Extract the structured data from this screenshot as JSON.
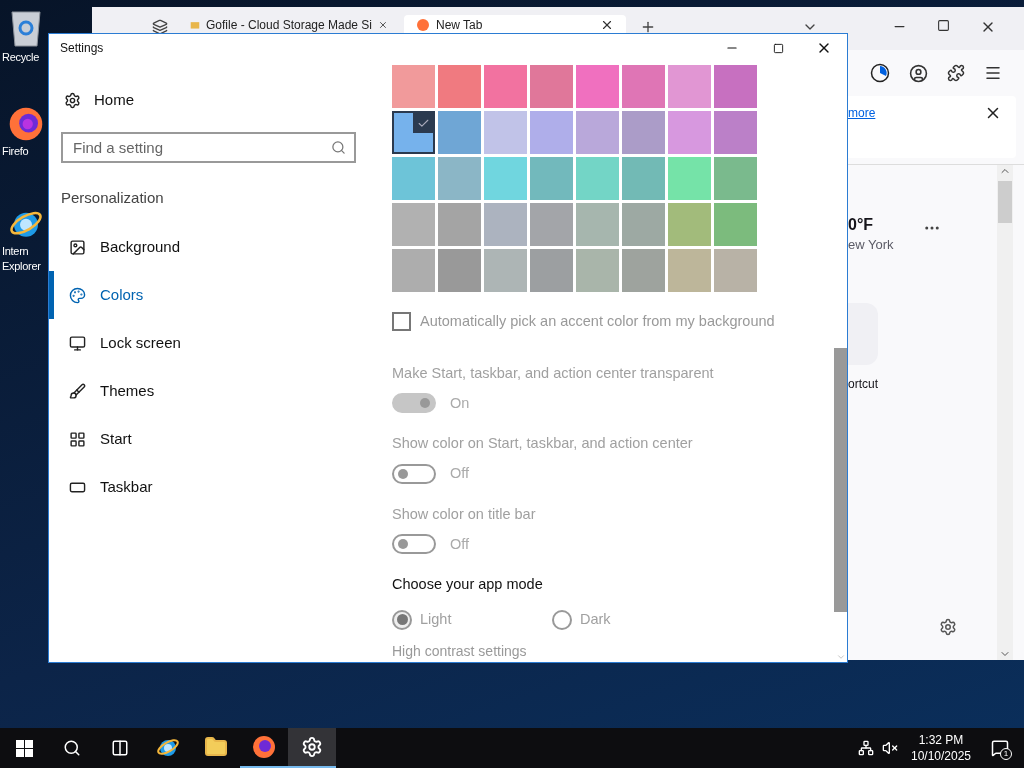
{
  "desktop_icons": [
    {
      "lines": [
        "Recycle"
      ]
    },
    {
      "lines": [
        "Firefo"
      ]
    },
    {
      "lines": [
        "Intern",
        "Explorer"
      ]
    }
  ],
  "browser": {
    "tabs": [
      {
        "label": "Gofile - Cloud Storage Made Si",
        "selected": false
      },
      {
        "label": "New Tab",
        "selected": true
      }
    ],
    "notice_link": "more",
    "weather": {
      "temp": "0°F",
      "city": "ew York"
    },
    "shortcut": "ortcut"
  },
  "settings": {
    "title": "Settings",
    "home": "Home",
    "search": {
      "placeholder": "Find a setting"
    },
    "section": "Personalization",
    "nav": [
      {
        "label": "Background",
        "selected": false
      },
      {
        "label": "Colors",
        "selected": true
      },
      {
        "label": "Lock screen",
        "selected": false
      },
      {
        "label": "Themes",
        "selected": false
      },
      {
        "label": "Start",
        "selected": false
      },
      {
        "label": "Taskbar",
        "selected": false
      }
    ],
    "swatches": [
      {
        "color": "#f19a9b",
        "selected": false
      },
      {
        "color": "#f07a80",
        "selected": false
      },
      {
        "color": "#f272a0",
        "selected": false
      },
      {
        "color": "#e0779a",
        "selected": false
      },
      {
        "color": "#f070bf",
        "selected": false
      },
      {
        "color": "#df75b5",
        "selected": false
      },
      {
        "color": "#e196d3",
        "selected": false
      },
      {
        "color": "#c770c0",
        "selected": false
      },
      {
        "color": "#76b2ec",
        "selected": true
      },
      {
        "color": "#6fa6d5",
        "selected": false
      },
      {
        "color": "#c1c3e8",
        "selected": false
      },
      {
        "color": "#afaeea",
        "selected": false
      },
      {
        "color": "#b9a8da",
        "selected": false
      },
      {
        "color": "#ab9cc8",
        "selected": false
      },
      {
        "color": "#d798df",
        "selected": false
      },
      {
        "color": "#bb80c8",
        "selected": false
      },
      {
        "color": "#6dc4d8",
        "selected": false
      },
      {
        "color": "#8bb6c6",
        "selected": false
      },
      {
        "color": "#70d6df",
        "selected": false
      },
      {
        "color": "#72b9bc",
        "selected": false
      },
      {
        "color": "#73d5c6",
        "selected": false
      },
      {
        "color": "#72bab5",
        "selected": false
      },
      {
        "color": "#75e3a8",
        "selected": false
      },
      {
        "color": "#7aba8d",
        "selected": false
      },
      {
        "color": "#b1b1b1",
        "selected": false
      },
      {
        "color": "#a4a4a4",
        "selected": false
      },
      {
        "color": "#acb3bf",
        "selected": false
      },
      {
        "color": "#a3a5a9",
        "selected": false
      },
      {
        "color": "#a6b6ae",
        "selected": false
      },
      {
        "color": "#9da9a3",
        "selected": false
      },
      {
        "color": "#a2bb7b",
        "selected": false
      },
      {
        "color": "#7cbb7d",
        "selected": false
      },
      {
        "color": "#adadad",
        "selected": false
      },
      {
        "color": "#999999",
        "selected": false
      },
      {
        "color": "#adb5b5",
        "selected": false
      },
      {
        "color": "#9c9fa1",
        "selected": false
      },
      {
        "color": "#a9b5aa",
        "selected": false
      },
      {
        "color": "#9ea39e",
        "selected": false
      },
      {
        "color": "#bdb69a",
        "selected": false
      },
      {
        "color": "#b8b2a6",
        "selected": false
      }
    ],
    "auto_pick": {
      "label": "Automatically pick an accent color from my background",
      "checked": false
    },
    "toggles": [
      {
        "label": "Make Start, taskbar, and action center transparent",
        "state_text": "On",
        "on": true,
        "disabled": true
      },
      {
        "label": "Show color on Start, taskbar, and action center",
        "state_text": "Off",
        "on": false,
        "disabled": true
      },
      {
        "label": "Show color on title bar",
        "state_text": "Off",
        "on": false,
        "disabled": true
      }
    ],
    "app_mode": {
      "heading": "Choose your app mode",
      "disabled": true,
      "options": [
        {
          "label": "Light",
          "selected": true
        },
        {
          "label": "Dark",
          "selected": false
        }
      ]
    },
    "link": "High contrast settings"
  },
  "taskbar": {
    "apps": [
      {
        "running": false,
        "selected": false
      },
      {
        "running": false,
        "selected": false
      },
      {
        "running": true,
        "selected": false
      },
      {
        "running": true,
        "selected": true
      }
    ],
    "time": "1:32 PM",
    "date": "10/10/2025",
    "notifications": "1"
  }
}
